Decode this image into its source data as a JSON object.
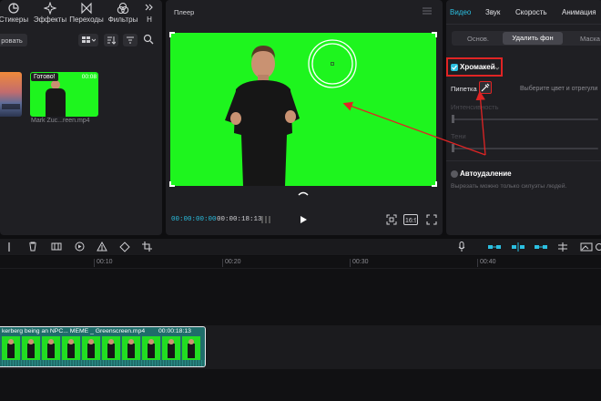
{
  "top_tabs": [
    {
      "label": "Стикеры",
      "icon": "clock-icon"
    },
    {
      "label": "Эффекты",
      "icon": "sparkle-icon"
    },
    {
      "label": "Переходы",
      "icon": "bowtie-icon"
    },
    {
      "label": "Фильтры",
      "icon": "filter-circles-icon"
    },
    {
      "label": "Н",
      "icon": "more-icon"
    }
  ],
  "media": {
    "import_label": "ровать",
    "clip_status": "Готово!",
    "clip_duration": "00:08",
    "clip_name": "Mark Zuc...reen.mp4"
  },
  "player": {
    "title": "Плеер",
    "current_time": "00:00:00:00",
    "total_time": "00:00:18:13"
  },
  "inspector": {
    "tabs": [
      "Видео",
      "Звук",
      "Скорость",
      "Анимация"
    ],
    "active_tab": "Видео",
    "subtabs": [
      "Основ.",
      "Удалить фон",
      "Маска"
    ],
    "active_subtab": "Удалить фон",
    "chromakey_label": "Хромакей",
    "pipette_label": "Пипетка",
    "pick_color_hint": "Выберите цвет и отрегули",
    "intensity_label": "Интенсивность",
    "shadow_label": "Тени",
    "auto_remove_label": "Автоудаление",
    "auto_remove_hint": "Вырезать можно только силуэты людей.",
    "chromakey_checked": true,
    "auto_remove_checked": false
  },
  "timeline": {
    "ruler_marks": [
      "00:10",
      "00:20",
      "00:30",
      "00:40"
    ],
    "clip_title": "kerberg being an NPC... MEME _ Greenscreen.mp4",
    "clip_duration": "00:00:18:13"
  },
  "colors": {
    "accent": "#2bbfe0",
    "green_screen": "#1ef51e",
    "highlight_red": "#e02424",
    "clip_teal": "#1f6d6a"
  }
}
